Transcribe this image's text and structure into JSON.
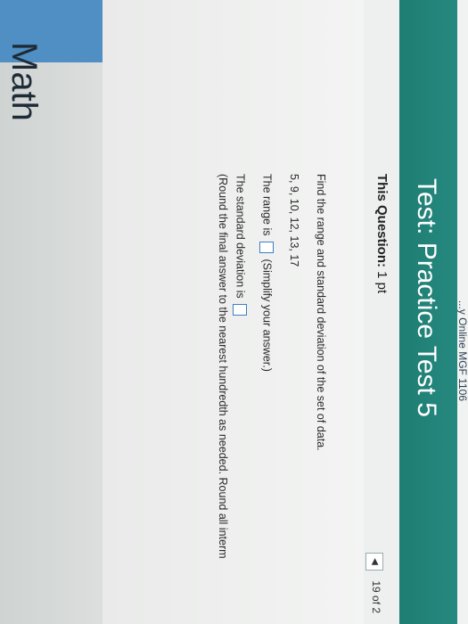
{
  "sidebar": {
    "title": "Math"
  },
  "course": {
    "name": "...y Online MGF 1106"
  },
  "test": {
    "title": "Test: Practice Test 5"
  },
  "question": {
    "label": "This Question:",
    "points": "1 pt",
    "nav": "19 of 2",
    "prompt": "Find the range and standard deviation of the set of data.",
    "data_set": "5, 9, 10, 12, 13, 17",
    "range_prefix": "The range is",
    "range_hint": "(Simplify your answer.)",
    "sd_prefix": "The standard deviation is",
    "sd_hint": "(Round the final answer to the nearest hundredth as needed. Round all interm"
  }
}
